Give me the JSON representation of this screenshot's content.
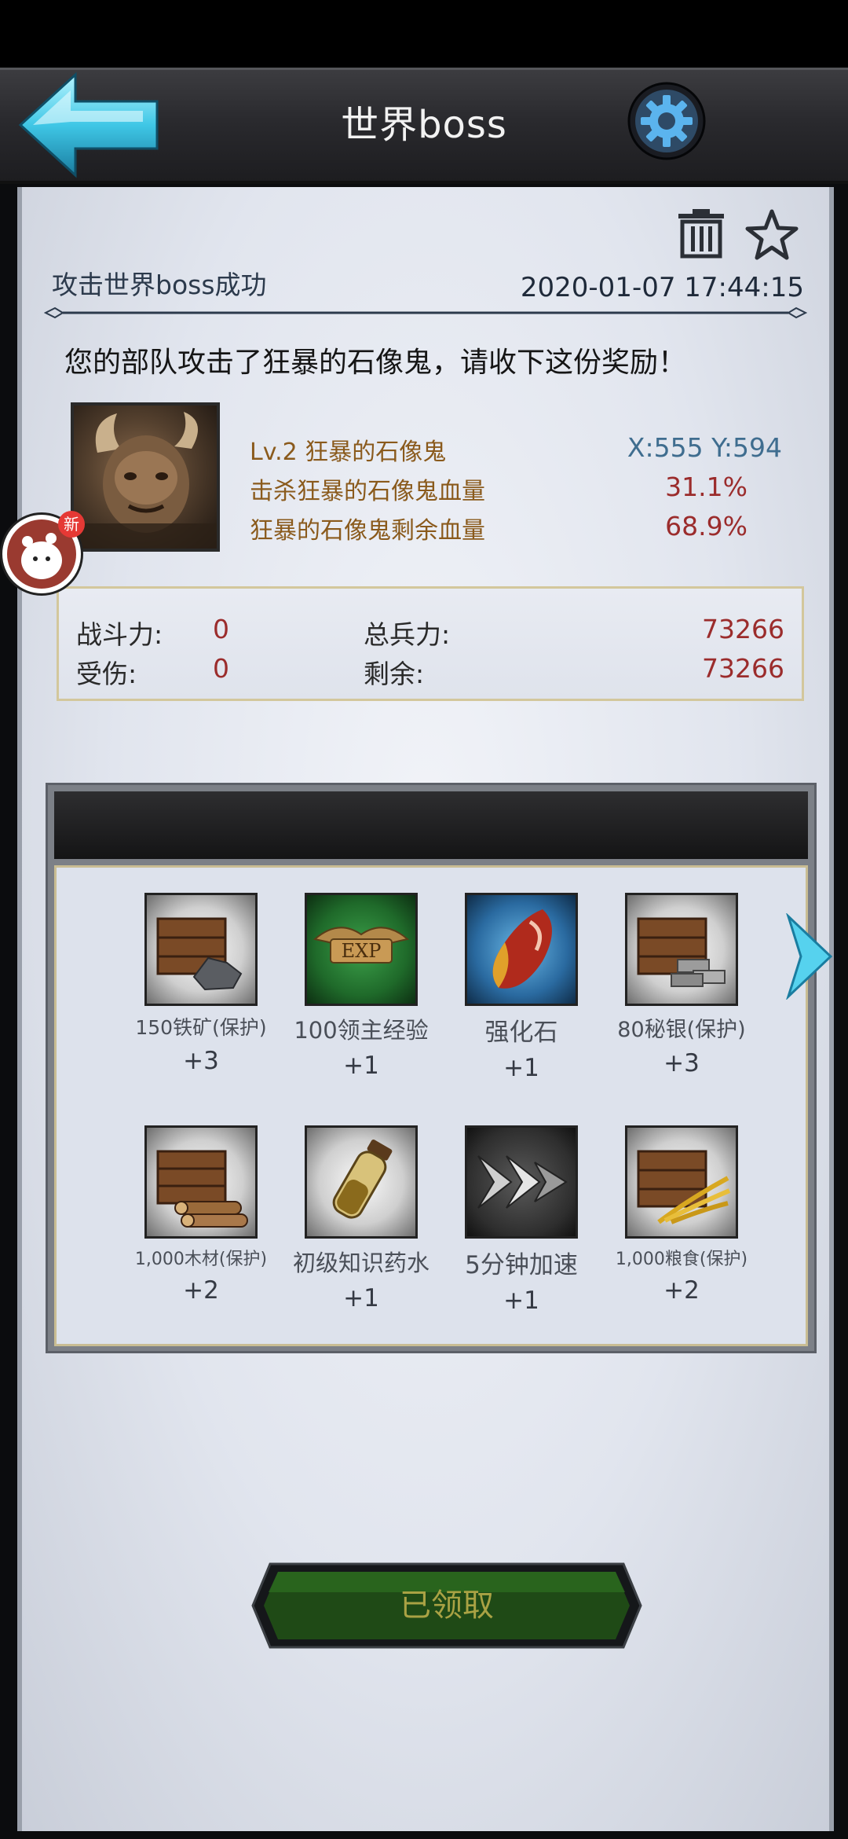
{
  "header": {
    "title": "世界boss"
  },
  "mail": {
    "subject": "攻击世界boss成功",
    "date": "2020-01-07 17:44:15",
    "message": "您的部队攻击了狂暴的石像鬼，请收下这份奖励！"
  },
  "boss": {
    "name": "Lv.2 狂暴的石像鬼",
    "coord": "X:555 Y:594",
    "kill_label": "击杀狂暴的石像鬼血量",
    "kill_value": "31.1%",
    "remaining_label": "狂暴的石像鬼剩余血量",
    "remaining_value": "68.9%"
  },
  "stats": {
    "power_label": "战斗力:",
    "power_value": "0",
    "damage_label": "受伤:",
    "damage_value": "0",
    "troops_label": "总兵力:",
    "troops_value": "73266",
    "remaining_label": "剩余:",
    "remaining_value": "73266"
  },
  "rewards": [
    {
      "name": "150铁矿(保护)",
      "count": "+3",
      "icon": "iron-ore-crate-icon"
    },
    {
      "name": "100领主经验",
      "count": "+1",
      "icon": "exp-icon"
    },
    {
      "name": "强化石",
      "count": "+1",
      "icon": "enhance-stone-icon"
    },
    {
      "name": "80秘银(保护)",
      "count": "+3",
      "icon": "mithril-crate-icon"
    },
    {
      "name": "1,000木材(保护)",
      "count": "+2",
      "icon": "wood-crate-icon"
    },
    {
      "name": "初级知识药水",
      "count": "+1",
      "icon": "knowledge-potion-icon"
    },
    {
      "name": "5分钟加速",
      "count": "+1",
      "icon": "speedup-icon"
    },
    {
      "name": "1,000粮食(保护)",
      "count": "+2",
      "icon": "grain-crate-icon"
    }
  ],
  "claim_button": {
    "label": "已领取"
  },
  "notification": {
    "badge": "新"
  },
  "colors": {
    "accent_gold": "#8a5a1c",
    "value_red": "#9b2c2c",
    "coord_blue": "#3f6d8f",
    "button_green": "#1f4a16"
  }
}
